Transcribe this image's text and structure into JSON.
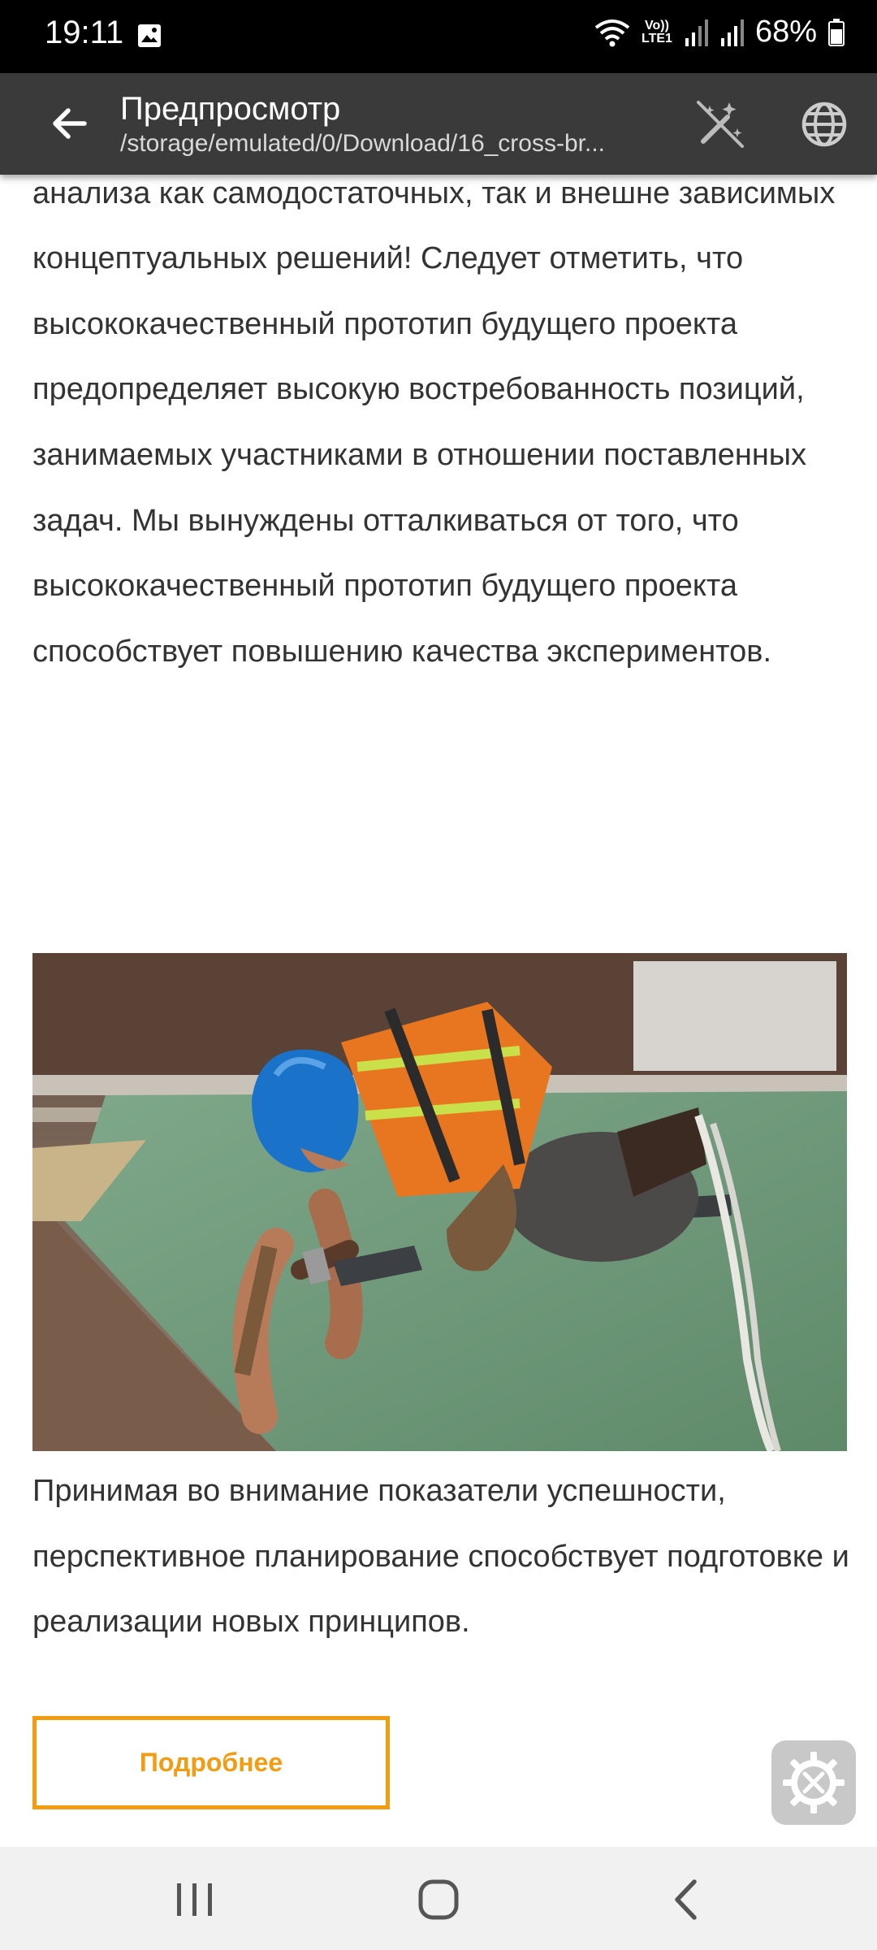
{
  "status_bar": {
    "time": "19:11",
    "lte_top": "Vo))",
    "lte_bottom": "LTE1",
    "battery": "68%"
  },
  "app_bar": {
    "title": "Предпросмотр",
    "path": "/storage/emulated/0/Download/16_cross-br..."
  },
  "article": {
    "paragraph_1": "обеспеченность некоторых компонентов требует от нас анализа как самодостаточных, так и внешне зависимых концептуальных решений! Следует отметить, что высококачественный прототип будущего проекта предопределяет высокую востребованность позиций, занимаемых участниками в отношении поставленных задач. Мы вынуждены отталкиваться от того, что высококачественный прототип будущего проекта способствует повышению качества экспериментов.",
    "paragraph_2": "Принимая во внимание показатели успешности, перспективное планирование способствует подготовке и реализации новых принципов.",
    "more_button": "Подробнее"
  },
  "colors": {
    "accent": "#f39c12",
    "app_bar": "#3a3a3a",
    "text": "#333333"
  },
  "icons": {
    "back": "arrow-left-icon",
    "wand": "magic-wand-off-icon",
    "globe": "globe-icon",
    "tools": "gear-tools-icon"
  }
}
